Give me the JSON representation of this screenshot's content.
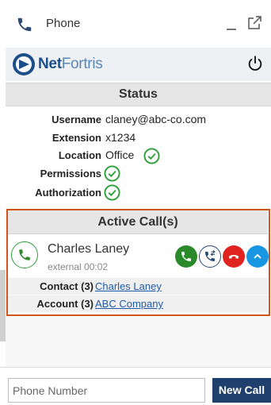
{
  "window": {
    "title": "Phone"
  },
  "brand": {
    "name_part1": "Net",
    "name_part2": "Fortris"
  },
  "status": {
    "header": "Status",
    "username_label": "Username",
    "username_value": "claney@abc-co.com",
    "extension_label": "Extension",
    "extension_value": "x1234",
    "location_label": "Location",
    "location_value": "Office",
    "permissions_label": "Permissions",
    "authorization_label": "Authorization"
  },
  "active_calls": {
    "header": "Active Call(s)",
    "caller_name": "Charles Laney",
    "caller_meta": "external 00:02",
    "contact_label": "Contact (3)",
    "contact_value": "Charles Laney",
    "account_label": "Account (3)",
    "account_value": "ABC Company"
  },
  "dialer": {
    "placeholder": "Phone Number",
    "new_call_label": "New Call"
  },
  "icons": {
    "title": "phone-icon",
    "minimize": "minimize-icon",
    "popout": "popout-icon",
    "power": "power-icon",
    "check": "check-circle-icon",
    "answer": "phone-answer-icon",
    "transfer": "call-transfer-icon",
    "hangup": "hangup-icon",
    "expand": "chevron-up-icon"
  },
  "colors": {
    "accent_border": "#d2541b",
    "answer": "#2a8a2a",
    "hangup": "#e0231f",
    "expand": "#1996e2",
    "new_call": "#1f3f6d",
    "check": "#2f9d3b"
  }
}
